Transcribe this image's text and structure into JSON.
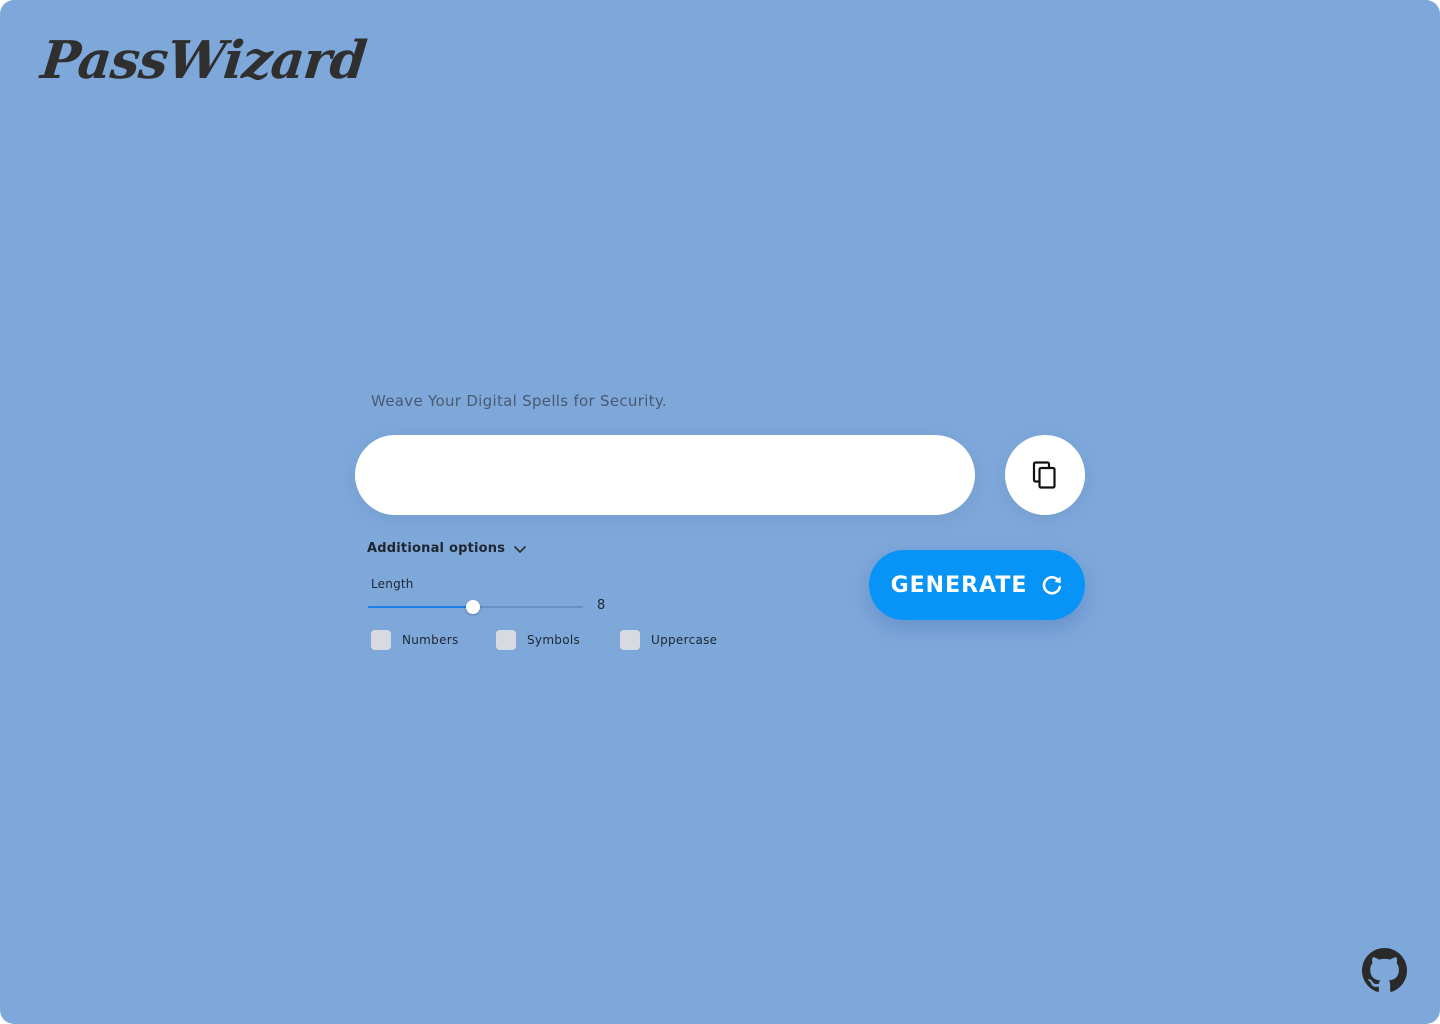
{
  "app": {
    "logo_text": "PassWizard",
    "tagline": "Weave Your Digital Spells for Security."
  },
  "password": {
    "value": "",
    "placeholder": ""
  },
  "copy_button": {
    "icon": "copy-icon"
  },
  "options": {
    "toggle_label": "Additional options",
    "toggle_icon": "chevron-down-icon",
    "length_label": "Length",
    "length_value": "8",
    "length_fraction": 0.49,
    "checkboxes": [
      {
        "label": "Numbers",
        "checked": false
      },
      {
        "label": "Symbols",
        "checked": false
      },
      {
        "label": "Uppercase",
        "checked": false
      }
    ]
  },
  "generate_button": {
    "label": "GENERATE",
    "icon": "refresh-icon"
  },
  "footer": {
    "icon": "github-icon"
  },
  "colors": {
    "background": "#7fa8da",
    "accent": "#0894f7",
    "slider_fill": "#1a7fe8",
    "checkbox": "#d7dbe1"
  }
}
